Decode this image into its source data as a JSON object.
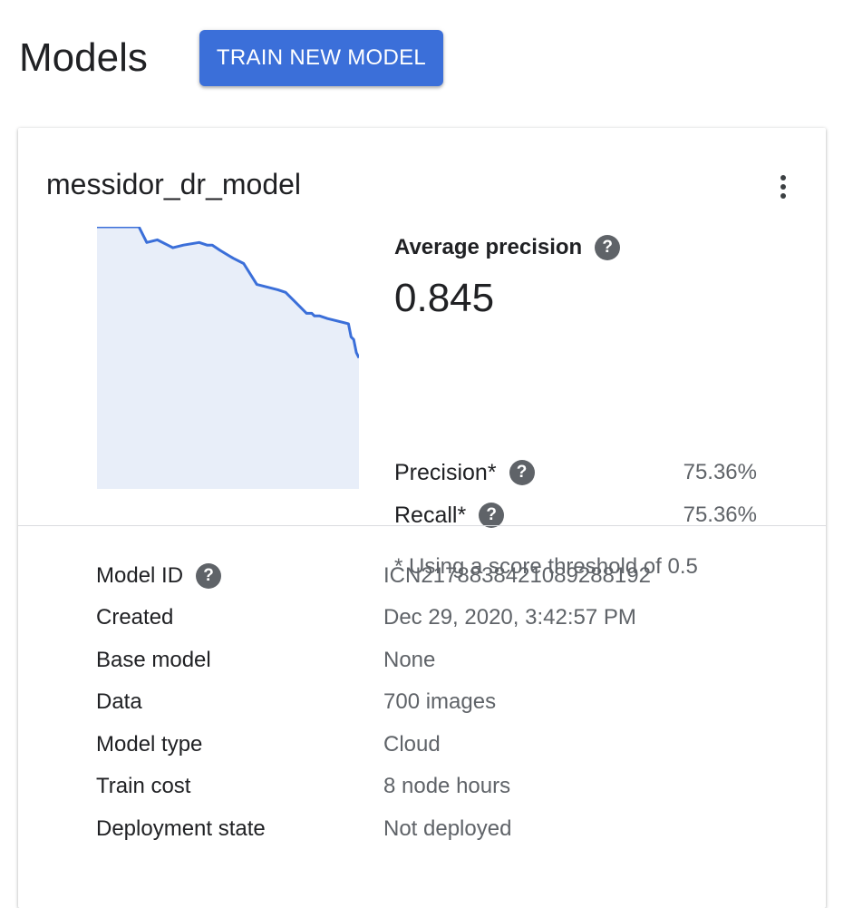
{
  "header": {
    "title": "Models",
    "train_button_label": "TRAIN NEW MODEL"
  },
  "model_card": {
    "name": "messidor_dr_model",
    "menu_icon": "more-vert-icon",
    "summary": {
      "average_precision_label": "Average precision",
      "average_precision_value": "0.845",
      "precision_label": "Precision*",
      "precision_value": "75.36%",
      "recall_label": "Recall*",
      "recall_value": "75.36%",
      "threshold_note": "* Using a score threshold of 0.5",
      "help_icon": "help-icon"
    },
    "details": [
      {
        "label": "Model ID",
        "value": "ICN2178838421089288192",
        "has_help": true
      },
      {
        "label": "Created",
        "value": "Dec 29, 2020, 3:42:57 PM",
        "has_help": false
      },
      {
        "label": "Base model",
        "value": "None",
        "has_help": false
      },
      {
        "label": "Data",
        "value": "700 images",
        "has_help": false
      },
      {
        "label": "Model type",
        "value": "Cloud",
        "has_help": false
      },
      {
        "label": "Train cost",
        "value": "8 node hours",
        "has_help": false
      },
      {
        "label": "Deployment state",
        "value": "Not deployed",
        "has_help": false
      }
    ]
  },
  "chart_data": {
    "type": "area",
    "title": "",
    "xlabel": "",
    "ylabel": "",
    "xlim": [
      0,
      1
    ],
    "ylim": [
      0,
      1
    ],
    "grid": false,
    "line_color": "#3b6fd9",
    "fill_color": "#e8eef9",
    "x": [
      0.0,
      0.16,
      0.19,
      0.23,
      0.27,
      0.29,
      0.33,
      0.39,
      0.42,
      0.44,
      0.47,
      0.52,
      0.56,
      0.61,
      0.69,
      0.72,
      0.77,
      0.8,
      0.82,
      0.83,
      0.85,
      0.88,
      0.96,
      0.97,
      0.98,
      0.99,
      1.0
    ],
    "y": [
      1.0,
      1.0,
      0.94,
      0.95,
      0.93,
      0.92,
      0.93,
      0.94,
      0.93,
      0.93,
      0.91,
      0.88,
      0.86,
      0.78,
      0.76,
      0.75,
      0.7,
      0.67,
      0.67,
      0.66,
      0.66,
      0.65,
      0.63,
      0.58,
      0.57,
      0.52,
      0.5
    ]
  }
}
